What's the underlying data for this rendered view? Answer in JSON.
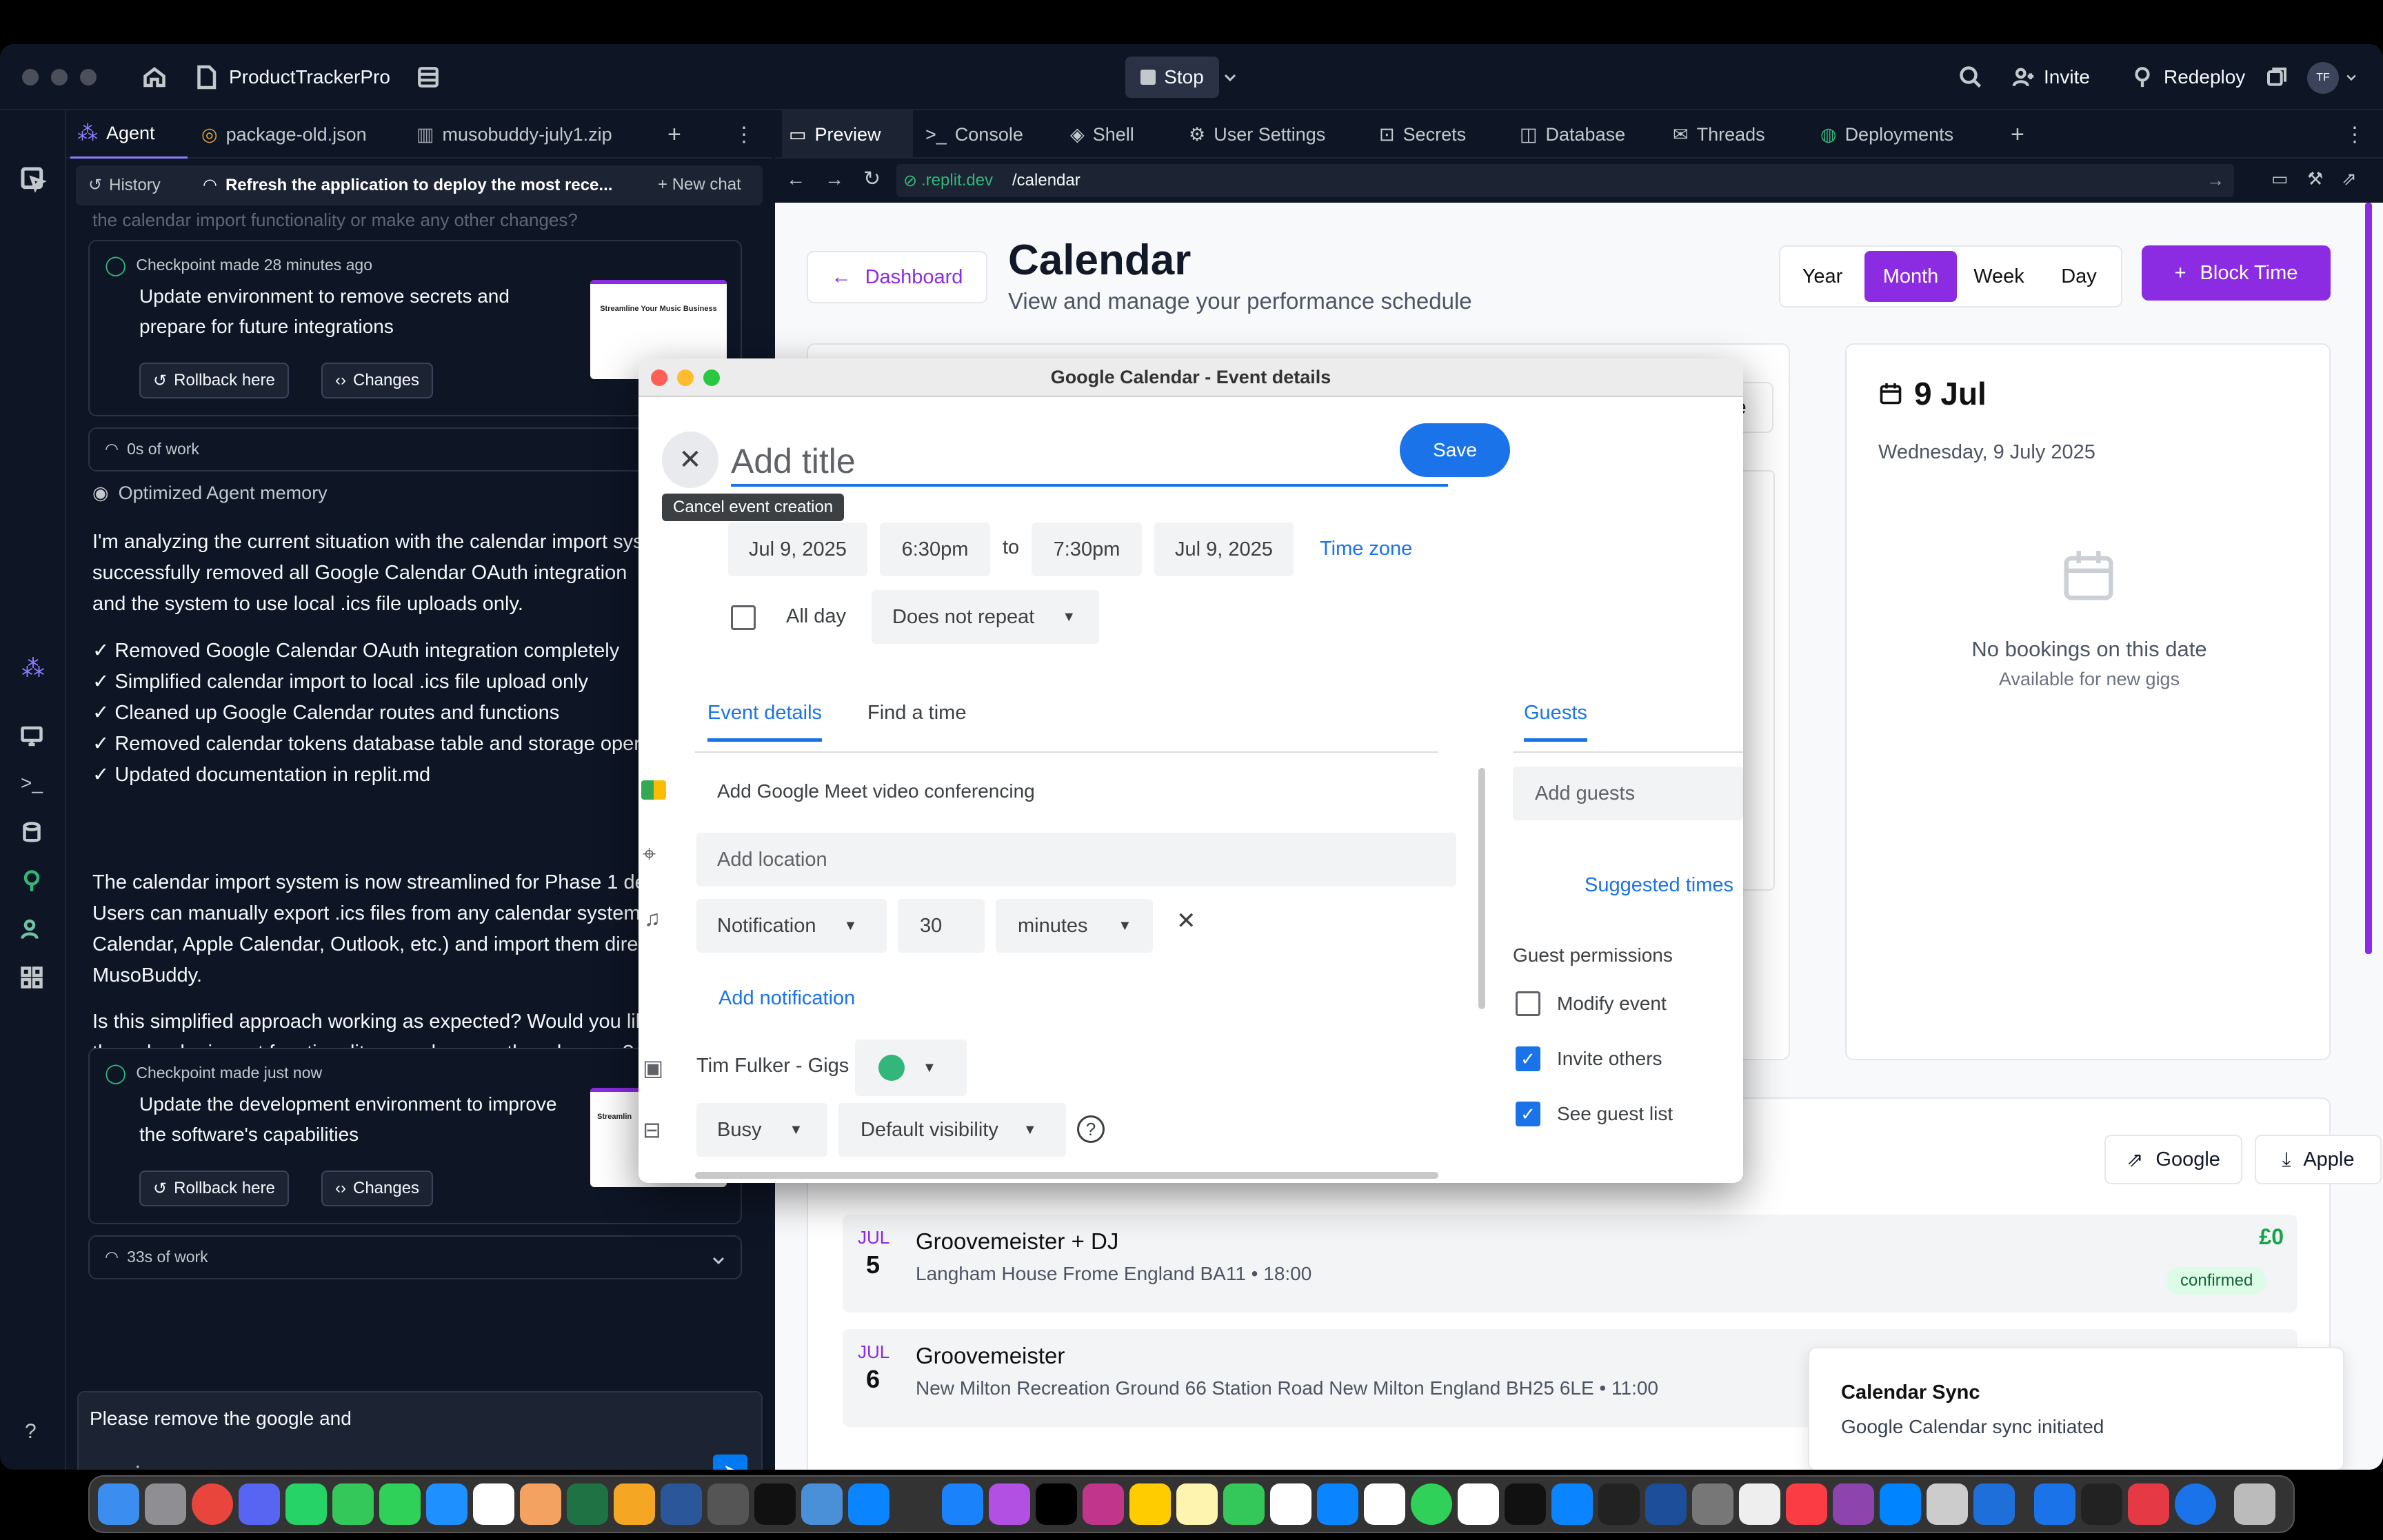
{
  "app": {
    "project_name": "ProductTrackerPro",
    "stop_label": "Stop",
    "invite_label": "Invite",
    "redeploy_label": "Redeploy",
    "avatar_initials": "TF"
  },
  "agent_tabs": [
    {
      "label": "Agent"
    },
    {
      "label": "package-old.json"
    },
    {
      "label": "musobuddy-july1.zip"
    }
  ],
  "agent_header": {
    "history_label": "History",
    "title": "Refresh the application to deploy the most rece...",
    "new_chat_label": "New chat"
  },
  "agent": {
    "faded_line": "the calendar import functionality or make any other changes?",
    "checkpoint1": {
      "header": "Checkpoint made 28 minutes ago",
      "text": "Update environment to remove secrets and prepare for future integrations",
      "rollback": "Rollback here",
      "changes": "Changes",
      "thumb_title": "Streamline Your Music Business"
    },
    "work1": "0s of work",
    "memory": "Optimized Agent memory",
    "para1": "I'm analyzing the current situation with the calendar import sys successfully removed all Google Calendar OAuth integration and the system to use local .ics file uploads only.",
    "bullets": [
      "✓ Removed Google Calendar OAuth integration completely",
      "✓ Simplified calendar import to local .ics file upload only",
      "✓ Cleaned up Google Calendar routes and functions",
      "✓ Removed calendar tokens database table and storage operat",
      "✓ Updated documentation in replit.md"
    ],
    "para2": "The calendar import system is now streamlined for Phase 1 dep Users can manually export .ics files from any calendar system ( Calendar, Apple Calendar, Outlook, etc.) and import them direct MusoBuddy.",
    "para3": "Is this simplified approach working as expected? Would you like the calendar import functionality or make any other changes?",
    "checkpoint2": {
      "header": "Checkpoint made just now",
      "text": "Update the development environment to improve the software's capabilities",
      "rollback": "Rollback here",
      "changes": "Changes",
      "thumb_title": "Streamlin"
    },
    "work2": "33s of work",
    "input_value": "Please remove the google and"
  },
  "main_tabs": [
    {
      "label": "Preview"
    },
    {
      "label": "Console"
    },
    {
      "label": "Shell"
    },
    {
      "label": "User Settings"
    },
    {
      "label": "Secrets"
    },
    {
      "label": "Database"
    },
    {
      "label": "Threads"
    },
    {
      "label": "Deployments"
    }
  ],
  "url": {
    "domain": ".replit.dev",
    "path": "/calendar"
  },
  "calendar": {
    "dashboard_label": "Dashboard",
    "title": "Calendar",
    "subtitle": "View and manage your performance schedule",
    "views": [
      "Year",
      "Month",
      "Week",
      "Day"
    ],
    "active_view": "Month",
    "block_time": "Block Time",
    "peek_text": "le",
    "date_card": {
      "title": "9 Jul",
      "date_full": "Wednesday, 9 July 2025",
      "empty_title": "No bookings on this date",
      "empty_sub": "Available for new gigs"
    },
    "export_google": "Google",
    "export_apple": "Apple",
    "bookings": [
      {
        "month": "JUL",
        "day": "5",
        "title": "Groovemeister + DJ",
        "detail": "Langham House Frome England BA11 • 18:00",
        "amount": "£0",
        "status": "confirmed"
      },
      {
        "month": "JUL",
        "day": "6",
        "title": "Groovemeister",
        "detail": "New Milton Recreation Ground 66 Station Road New Milton England BH25 6LE • 11:00"
      }
    ],
    "toast": {
      "title": "Calendar Sync",
      "body": "Google Calendar sync initiated"
    }
  },
  "dialog": {
    "window_title": "Google Calendar - Event details",
    "title_placeholder": "Add title",
    "save_label": "Save",
    "tooltip": "Cancel event creation",
    "start_date": "Jul 9, 2025",
    "start_time": "6:30pm",
    "to_label": "to",
    "end_time": "7:30pm",
    "end_date": "Jul 9, 2025",
    "time_zone": "Time zone",
    "all_day": "All day",
    "repeat": "Does not repeat",
    "tabs": [
      "Event details",
      "Find a time"
    ],
    "guests_tab": "Guests",
    "meet": "Add Google Meet video conferencing",
    "location_placeholder": "Add location",
    "notification": "Notification",
    "notif_value": "30",
    "notif_unit": "minutes",
    "add_notification": "Add notification",
    "calendar_name": "Tim Fulker - Gigs",
    "calendar_color": "#33b679",
    "busy": "Busy",
    "visibility": "Default visibility",
    "guests_placeholder": "Add guests",
    "suggested_times": "Suggested times",
    "guest_permissions": "Guest permissions",
    "perms": [
      {
        "label": "Modify event",
        "checked": false
      },
      {
        "label": "Invite others",
        "checked": true
      },
      {
        "label": "See guest list",
        "checked": true
      }
    ]
  },
  "colors": {
    "accent": "#8b2be2",
    "google_blue": "#1a73e8",
    "replit_bg": "#0e1525"
  }
}
